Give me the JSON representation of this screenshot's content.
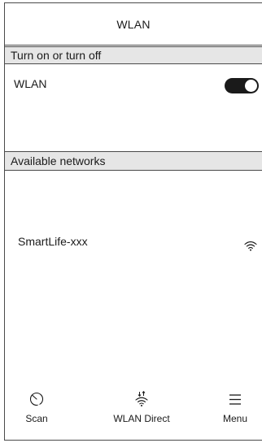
{
  "header": {
    "title": "WLAN"
  },
  "sections": {
    "toggle_header": "Turn on or turn off",
    "networks_header": "Available networks"
  },
  "wlan_toggle": {
    "label": "WLAN",
    "state": "on"
  },
  "networks": [
    {
      "ssid": "SmartLife-xxx",
      "icon": "wifi-signal-icon"
    }
  ],
  "bottom_bar": {
    "scan_label": "Scan",
    "direct_label": "WLAN Direct",
    "menu_label": "Menu"
  },
  "colors": {
    "toggle_on": "#1a1a1a",
    "section_bg": "#e6e6e6",
    "border": "#4a4a4a"
  }
}
